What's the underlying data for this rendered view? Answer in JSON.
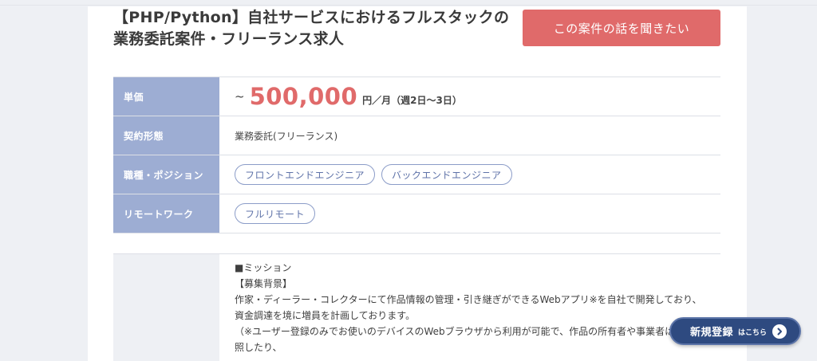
{
  "job": {
    "title": "【PHP/Python】自社サービスにおけるフルスタックの業務委託案件・フリーランス求人",
    "cta_label": "この案件の話を聞きたい"
  },
  "details": {
    "price": {
      "label": "単価",
      "tilde": "~",
      "value": "500,000",
      "unit": "円／月（週2日〜3日）"
    },
    "contract": {
      "label": "契約形態",
      "value": "業務委託(フリーランス)"
    },
    "position": {
      "label": "職種・ポジション",
      "tags": [
        "フロントエンドエンジニア",
        "バックエンドエンジニア"
      ]
    },
    "remote": {
      "label": "リモートワーク",
      "tags": [
        "フルリモート"
      ]
    }
  },
  "description": {
    "lines": [
      "■ミッション",
      "【募集背景】",
      "作家・ディーラー・コレクターにて作品情報の管理・引き継ぎができるWebアプリ※を自社で開発しており、",
      "資金調達を境に増員を計画しております。",
      "（※ユーザー登録のみでお使いのデバイスのWebブラウザから利用が可能で、作品の所有者や事業者は情",
      "照したり、"
    ]
  },
  "floating": {
    "register_main": "新規登録",
    "register_sub": "はこちら",
    "arrow_icon": "chevron-right-icon"
  }
}
